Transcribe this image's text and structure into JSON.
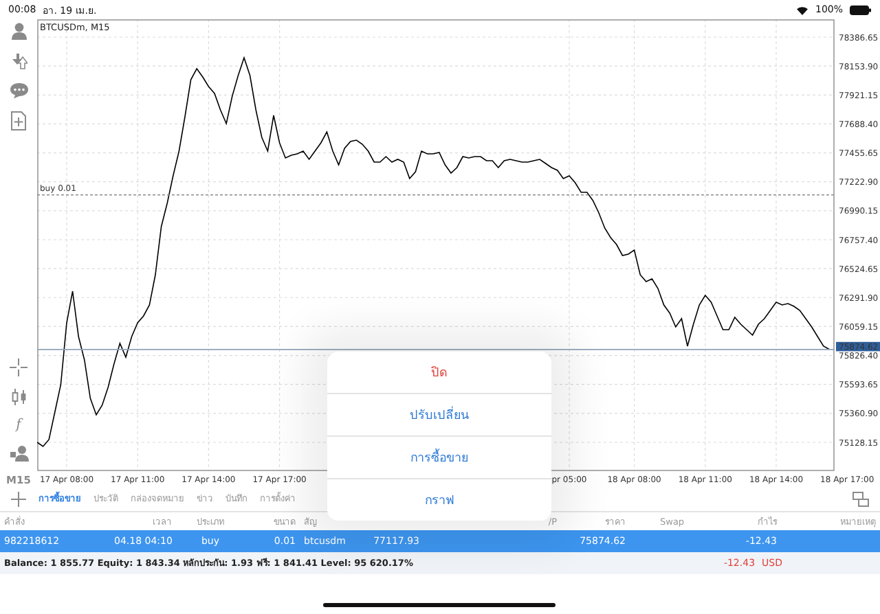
{
  "status_bar": {
    "time": "00:08",
    "date": "อา. 19 เม.ย.",
    "battery": "100%"
  },
  "toolbar": {
    "top": [
      {
        "kind": "account"
      },
      {
        "kind": "trade"
      },
      {
        "kind": "chat"
      },
      {
        "kind": "new_order"
      }
    ],
    "bottom": [
      {
        "kind": "crosshair"
      },
      {
        "kind": "candles"
      },
      {
        "kind": "text",
        "text": "f"
      },
      {
        "kind": "objects"
      },
      {
        "kind": "text",
        "text": "M15"
      }
    ]
  },
  "chart": {
    "chart_data": {
      "type": "line",
      "grid": true,
      "categories": [
        null,
        null,
        null,
        null,
        null,
        "17 Apr 08:00",
        null,
        null,
        null,
        null,
        null,
        null,
        null,
        null,
        null,
        null,
        null,
        "17 Apr 11:00",
        null,
        null,
        null,
        null,
        null,
        null,
        null,
        null,
        null,
        null,
        null,
        "17 Apr 14:00",
        null,
        null,
        null,
        null,
        null,
        null,
        null,
        null,
        null,
        null,
        null,
        "17 Apr 17:00",
        null,
        null,
        null,
        null,
        null,
        null,
        null,
        null,
        null,
        null,
        null,
        null,
        null,
        null,
        null,
        null,
        null,
        null,
        null,
        null,
        null,
        null,
        null,
        null,
        null,
        null,
        null,
        null,
        null,
        null,
        null,
        null,
        null,
        null,
        null,
        null,
        null,
        null,
        null,
        null,
        null,
        null,
        null,
        null,
        null,
        null,
        null,
        null,
        "pr 05:00",
        null,
        null,
        null,
        null,
        null,
        null,
        null,
        null,
        null,
        null,
        "18 Apr 08:00",
        null,
        null,
        null,
        null,
        null,
        null,
        null,
        null,
        null,
        null,
        null,
        "18 Apr 11:00",
        null,
        null,
        null,
        null,
        null,
        null,
        null,
        null,
        null,
        null,
        null,
        "18 Apr 14:00",
        null,
        null,
        null,
        null,
        null,
        null,
        null,
        null,
        null,
        null,
        null,
        "18 Apr 17:00"
      ],
      "series": [
        {
          "color": "#000000",
          "values": [
            75128,
            75095,
            75150,
            75371,
            75592,
            76089,
            76343,
            75979,
            75791,
            75482,
            75349,
            75426,
            75570,
            75758,
            75923,
            75813,
            75979,
            76089,
            76144,
            76233,
            76476,
            76862,
            77050,
            77271,
            77470,
            77746,
            78044,
            78133,
            78066,
            77989,
            77934,
            77801,
            77691,
            77912,
            78077,
            78221,
            78077,
            77801,
            77580,
            77470,
            77757,
            77536,
            77415,
            77437,
            77448,
            77470,
            77404,
            77470,
            77536,
            77624,
            77470,
            77359,
            77492,
            77547,
            77558,
            77525,
            77470,
            77381,
            77381,
            77426,
            77381,
            77404,
            77381,
            77249,
            77304,
            77470,
            77448,
            77448,
            77459,
            77359,
            77293,
            77337,
            77426,
            77415,
            77426,
            77426,
            77393,
            77393,
            77337,
            77393,
            77404,
            77393,
            77381,
            77381,
            77393,
            77404,
            77370,
            77337,
            77315,
            77249,
            77271,
            77216,
            77138,
            77138,
            77072,
            76973,
            76851,
            76774,
            76719,
            76630,
            76641,
            76675,
            76476,
            76420,
            76443,
            76365,
            76233,
            76166,
            76056,
            76122,
            75901,
            76078,
            76233,
            76310,
            76255,
            76144,
            76034,
            76034,
            76133,
            76078,
            76034,
            75990,
            76078,
            76122,
            76188,
            76255,
            76233,
            76244,
            76222,
            76188,
            76122,
            76056,
            75979,
            75901,
            75875,
            null,
            null,
            null
          ]
        }
      ],
      "ylim": [
        74896.1,
        78530.2
      ],
      "title": "BTCUSDm, M15",
      "yticks": [
        {
          "value": 78386.65,
          "label": "78386.65"
        },
        {
          "value": 78153.9,
          "label": "78153.90"
        },
        {
          "value": 77921.15,
          "label": "77921.15"
        },
        {
          "value": 77688.4,
          "label": "77688.40"
        },
        {
          "value": 77455.65,
          "label": "77455.65"
        },
        {
          "value": 77222.9,
          "label": "77222.90"
        },
        {
          "value": 76990.15,
          "label": "76990.15"
        },
        {
          "value": 76757.4,
          "label": "76757.40"
        },
        {
          "value": 76524.65,
          "label": "76524.65"
        },
        {
          "value": 76291.9,
          "label": "76291.90"
        },
        {
          "value": 76059.15,
          "label": "76059.15"
        },
        {
          "value": 75826.4,
          "label": "75826.40"
        },
        {
          "value": 75593.65,
          "label": "75593.65"
        },
        {
          "value": 75360.9,
          "label": "75360.90"
        },
        {
          "value": 75128.15,
          "label": "75128.15"
        }
      ],
      "ref_lines": [
        {
          "axis": "y",
          "value": 77117.93,
          "label": "buy 0.01"
        },
        {
          "axis": "y",
          "value": 75874.62,
          "label": "75874.62"
        }
      ]
    }
  },
  "tabs": [
    {
      "label": "การซื้อขาย",
      "selected": true
    },
    {
      "label": "ประวัติ",
      "selected": false
    },
    {
      "label": "กล่องจดหมาย",
      "selected": false
    },
    {
      "label": "ข่าว",
      "selected": false
    },
    {
      "label": "บันทึก",
      "selected": false
    },
    {
      "label": "การตั้งค่า",
      "selected": false
    }
  ],
  "table": {
    "columns": [
      "คำสั่ง",
      "เวลา",
      "ประเภท",
      "ขนาด",
      "สัญ",
      null,
      null,
      "/P",
      "ราคา",
      "Swap",
      "กำไร",
      "หมายเหตุ"
    ],
    "rows": [
      {
        "selected": true,
        "cells": [
          "982218612",
          "04.18 04:10",
          "buy",
          "0.01",
          "btcusdm",
          "77117.93",
          "",
          "",
          "75874.62",
          "",
          "-12.43"
        ]
      }
    ]
  },
  "summary": {
    "text": "Balance: 1 855.77 Equity: 1 843.34 หลักประกัน: 1.93 ฟรี: 1 841.41 Level: 95 620.17%",
    "profit": "-12.43",
    "currency": "USD"
  },
  "menu": [
    {
      "label": "ปิด",
      "kind": "destructive"
    },
    {
      "label": "ปรับเปลี่ยน",
      "kind": "action"
    },
    {
      "label": "การซื้อขาย",
      "kind": "action"
    },
    {
      "label": "กราฟ",
      "kind": "action"
    }
  ]
}
